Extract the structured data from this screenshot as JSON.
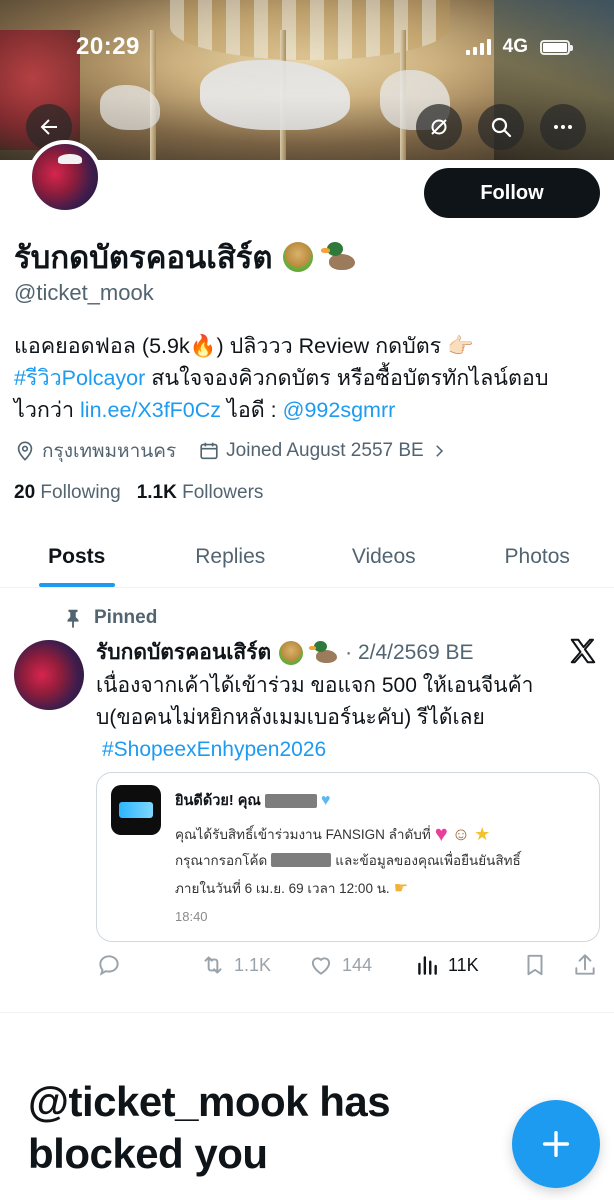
{
  "status_bar": {
    "time": "20:29",
    "network": "4G"
  },
  "profile": {
    "display_name": "รับกดบัตรคอนเสิร์ต",
    "handle": "@ticket_mook",
    "follow_label": "Follow",
    "bio": {
      "line1": "แอคยอดฟอล (5.9k🔥) ปลิววว Review กดบัตร 👉🏻",
      "hashtag": "#รีวิวPolcayor",
      "line2_rest": " สนใจจองคิวกดบัตร หรือซื้อบัตรทักไลน์ตอบ",
      "line3_prefix": "ไวกว่า ",
      "link": "lin.ee/X3fF0Cz",
      "line3_mid": " ไอดี : ",
      "line_id": "@992sgmrr"
    },
    "location": "กรุงเทพมหานคร",
    "joined": "Joined August 2557 BE",
    "following_count": "20",
    "following_label": "Following",
    "followers_count": "1.1K",
    "followers_label": "Followers"
  },
  "tabs": [
    {
      "label": "Posts",
      "active": true
    },
    {
      "label": "Replies",
      "active": false
    },
    {
      "label": "Videos",
      "active": false
    },
    {
      "label": "Photos",
      "active": false
    }
  ],
  "post": {
    "pinned_label": "Pinned",
    "author": "รับกดบัตรคอนเสิร์ต",
    "date": "· 2/4/2569 BE",
    "text_line1": "เนื่องจากเค้าได้เข้าร่วม ขอแจก 500 ให้เอนจีนค้า",
    "text_line2": "บ(ขอคนไม่หยิกหลังเมมเบอร์นะคับ) รีได้เลย",
    "hashtag": "#ShopeexEnhypen2026",
    "card": {
      "title": "ยินดีด้วย! คุณ",
      "line1": "คุณได้รับสิทธิ์เข้าร่วมงาน FANSIGN ลำดับที่",
      "line2a": "กรุณากรอกโค้ด",
      "line2b": "และข้อมูลของคุณเพื่อยืนยันสิทธิ์",
      "line3": "ภายในวันที่ 6 เม.ย. 69 เวลา 12:00 น.",
      "time": "18:40"
    },
    "actions": {
      "retweets": "1.1K",
      "likes": "144",
      "views": "11K"
    }
  },
  "blocked_message": "@ticket_mook has blocked you",
  "colors": {
    "accent": "#1d9bf0",
    "text": "#0f1419",
    "muted": "#536471"
  }
}
